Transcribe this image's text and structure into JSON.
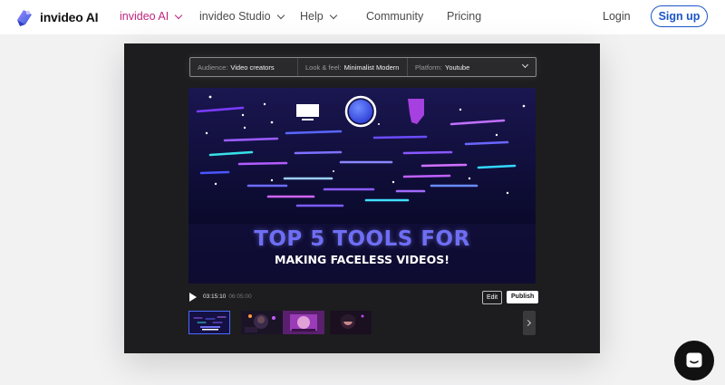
{
  "colors": {
    "brand_pink": "#c0237d",
    "signup_blue": "#1a56c8",
    "panel_bg": "#1d1d1f",
    "headline_blue": "#6e6ef5"
  },
  "nav": {
    "logo_text": "invideo AI",
    "items": [
      {
        "label": "invideo AI",
        "dropdown": true,
        "active": true
      },
      {
        "label": "invideo Studio",
        "dropdown": true
      },
      {
        "label": "Help",
        "dropdown": true
      },
      {
        "label": "Community"
      },
      {
        "label": "Pricing"
      }
    ],
    "login": "Login",
    "signup": "Sign up"
  },
  "settings": {
    "audience_label": "Audience:",
    "audience_value": "Video creators",
    "look_label": "Look & feel:",
    "look_value": "Minimalist Modern",
    "platform_label": "Platform:",
    "platform_value": "Youtube"
  },
  "video": {
    "title_line1": "TOP 5 TOOLS FOR",
    "title_line2": "MAKING FACELESS VIDEOS!"
  },
  "player": {
    "current_time": "03:15:10",
    "duration": "06:05:00",
    "edit": "Edit",
    "publish": "Publish"
  },
  "thumbnails": [
    {
      "name": "thumb-1",
      "selected": true
    },
    {
      "name": "thumb-2"
    },
    {
      "name": "thumb-3"
    },
    {
      "name": "thumb-4"
    }
  ],
  "icons": [
    "logo-icon",
    "chevron-down-icon",
    "play-icon",
    "chevron-right-icon",
    "chat-icon"
  ]
}
